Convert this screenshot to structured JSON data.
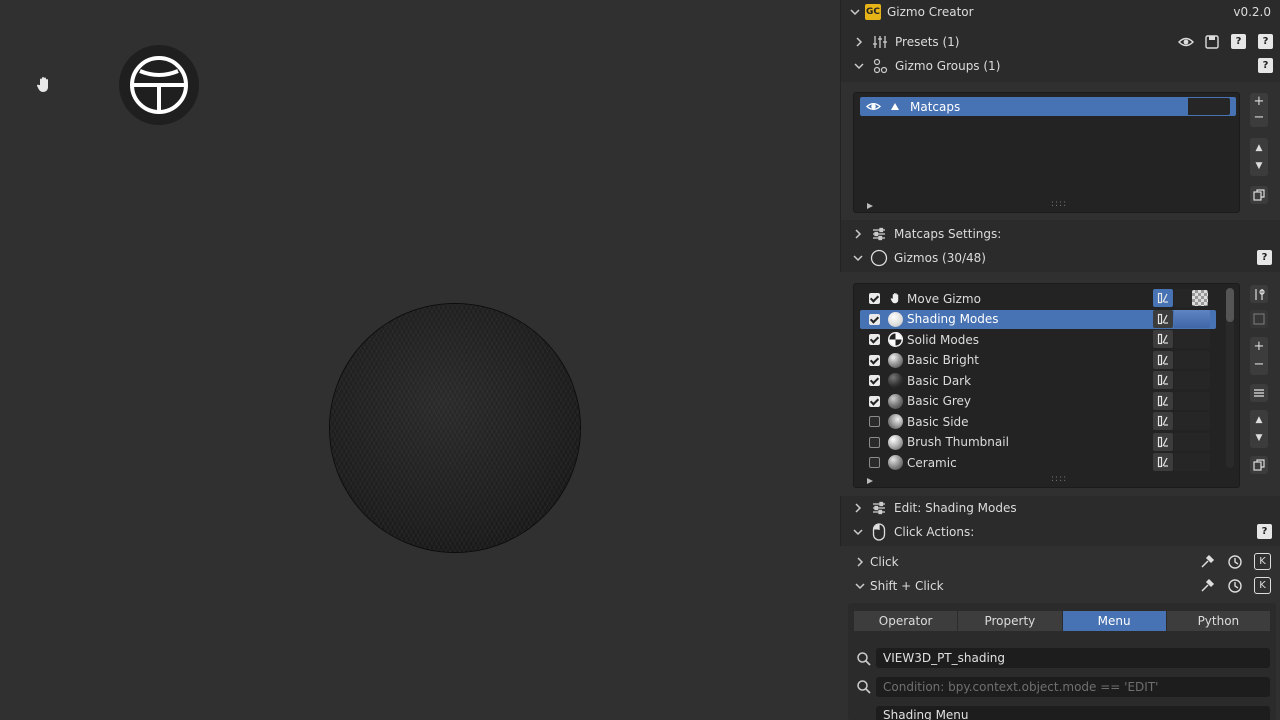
{
  "panel": {
    "title": "Gizmo Creator",
    "version": "v0.2.0",
    "logo_text": "GC"
  },
  "sections": {
    "presets": "Presets (1)",
    "gizmo_groups": "Gizmo Groups (1)",
    "matcaps_settings": "Matcaps Settings:",
    "gizmos": "Gizmos (30/48)",
    "edit_shading": "Edit: Shading Modes",
    "click_actions": "Click Actions:",
    "click": "Click",
    "shift_click": "Shift + Click"
  },
  "groups": [
    {
      "name": "Matcaps",
      "selected": true
    }
  ],
  "gizmos": [
    {
      "name": "Move Gizmo",
      "checked": true,
      "icon": "hand-icon"
    },
    {
      "name": "Shading Modes",
      "checked": true,
      "icon": "sphere-icon",
      "selected": true
    },
    {
      "name": "Solid Modes",
      "checked": true,
      "icon": "solid-modes-icon"
    },
    {
      "name": "Basic Bright",
      "checked": true,
      "icon": "matcap-ball-icon"
    },
    {
      "name": "Basic Dark",
      "checked": true,
      "icon": "matcap-ball-icon"
    },
    {
      "name": "Basic Grey",
      "checked": true,
      "icon": "matcap-ball-icon"
    },
    {
      "name": "Basic Side",
      "checked": false,
      "icon": "matcap-ball-icon"
    },
    {
      "name": "Brush Thumbnail",
      "checked": false,
      "icon": "matcap-ball-icon"
    },
    {
      "name": "Ceramic",
      "checked": false,
      "icon": "matcap-ball-icon"
    }
  ],
  "action_tabs": [
    "Operator",
    "Property",
    "Menu",
    "Python"
  ],
  "active_tab": "Menu",
  "fields": {
    "menu_id": "VIEW3D_PT_shading",
    "condition_placeholder": "Condition: bpy.context.object.mode == 'EDIT'",
    "label": "Shading Menu"
  },
  "colors": {
    "accent": "#4772b3",
    "panel_bg": "#2b2b2b",
    "viewport_bg": "#303030"
  }
}
